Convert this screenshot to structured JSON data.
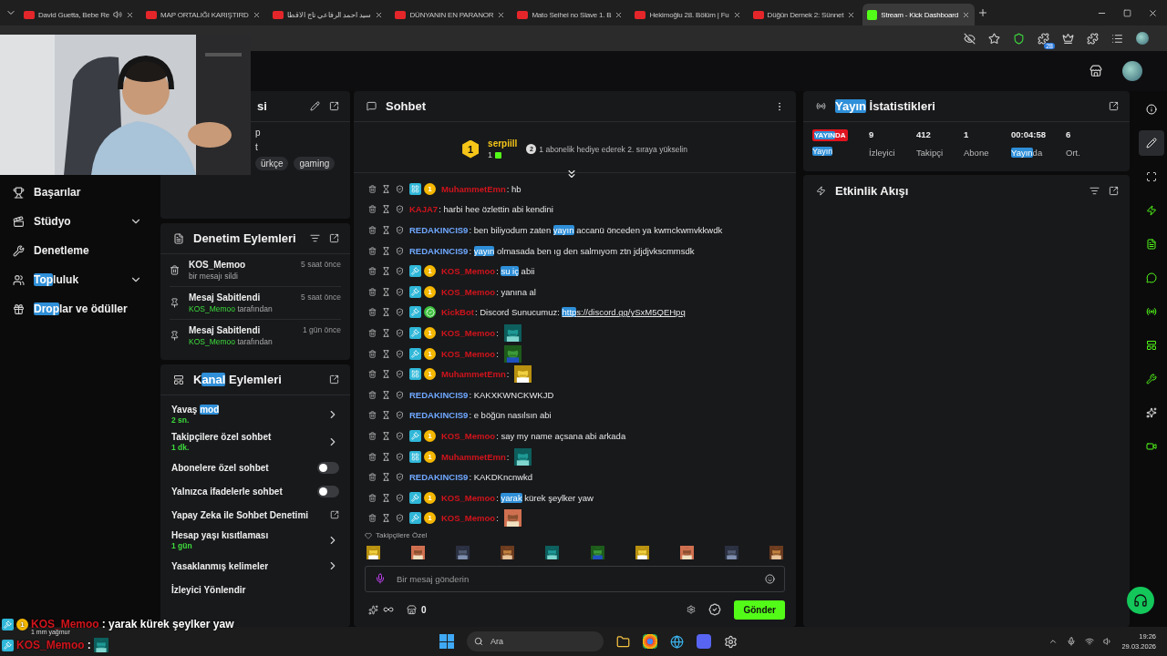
{
  "browser": {
    "tabs": [
      {
        "title": "David Guetta, Bebe Re",
        "selected": false,
        "audio": true
      },
      {
        "title": "MAP ORTALIĞI KARIŞTIRD",
        "selected": false,
        "audio": false
      },
      {
        "title": "سيد احمد الرفاعي تاج الاقطا",
        "selected": false,
        "audio": false
      },
      {
        "title": "DÜNYANIN EN PARANOR",
        "selected": false,
        "audio": false
      },
      {
        "title": "Mato Seihei no Slave 1. B",
        "selected": false,
        "audio": false
      },
      {
        "title": "Hekimoğlu 28. Bölüm | Fu",
        "selected": false,
        "audio": false
      },
      {
        "title": "Düğün Dernek 2: Sünnet",
        "selected": false,
        "audio": false
      },
      {
        "title": "Stream - Kick Dashboard",
        "selected": true,
        "audio": false
      }
    ],
    "extension_badge": "28"
  },
  "sidebar": {
    "items": [
      {
        "parts": [
          {
            "text": "Başarılar"
          }
        ],
        "expandable": false
      },
      {
        "parts": [
          {
            "text": "Stüdyo"
          }
        ],
        "expandable": true
      },
      {
        "parts": [
          {
            "text": "Denetleme"
          }
        ],
        "expandable": false
      },
      {
        "parts": [
          {
            "text": "Top",
            "highlighted": true
          },
          {
            "text": "luluk"
          }
        ],
        "expandable": true
      },
      {
        "parts": [
          {
            "text": "Drop",
            "highlighted": true
          },
          {
            "text": "lar ve ödüller"
          }
        ],
        "expandable": false
      }
    ]
  },
  "info_panel": {
    "title": "si",
    "lines": [
      "p",
      "t"
    ],
    "tags": [
      "ürkçe",
      "gaming"
    ]
  },
  "moderation": {
    "title": [
      {
        "text": "Denetim Eylemleri"
      }
    ],
    "entries": [
      {
        "kind": "delete",
        "title": "KOS_Memoo",
        "time": "5 saat önce",
        "detail": "bir mesajı sildi"
      },
      {
        "kind": "pin",
        "title": "Mesaj Sabitlendi",
        "time": "5 saat önce",
        "user": "KOS_Memoo",
        "detail": "tarafından"
      },
      {
        "kind": "pin",
        "title": "Mesaj Sabitlendi",
        "time": "1 gün önce",
        "user": "KOS_Memoo",
        "detail": "tarafından"
      }
    ]
  },
  "channel_actions": {
    "title": [
      {
        "text": "K"
      },
      {
        "text": "anal",
        "highlighted": true
      },
      {
        "text": " Eylemleri"
      }
    ],
    "items": [
      {
        "kind": "link",
        "label": [
          {
            "text": "Yavaş "
          },
          {
            "text": "mod",
            "highlighted": true
          }
        ],
        "value": "2 sn."
      },
      {
        "kind": "link",
        "label": [
          {
            "text": "Takipçilere özel sohbet"
          }
        ],
        "value": "1 dk."
      },
      {
        "kind": "toggle",
        "label": [
          {
            "text": "Abonelere özel sohbet"
          }
        ],
        "on": false
      },
      {
        "kind": "toggle",
        "label": [
          {
            "text": "Yalnızca ifadelerle sohbet"
          }
        ],
        "on": false
      },
      {
        "kind": "external",
        "label": [
          {
            "text": "Yapay Zeka ile Sohbet Denetimi"
          }
        ]
      },
      {
        "kind": "link",
        "label": [
          {
            "text": "Hesap yaşı kısıtlaması"
          }
        ],
        "value": "1 gün"
      },
      {
        "kind": "link",
        "label": [
          {
            "text": "Yasaklanmış kelimeler"
          }
        ]
      },
      {
        "kind": "plain",
        "label": [
          {
            "text": "İzleyici Yönlendir"
          }
        ]
      }
    ]
  },
  "chat": {
    "title": "Sohbet",
    "leader": {
      "rank": "1",
      "name": "serpiill",
      "count": "1",
      "hint_rank": "2",
      "hint": "1 abonelik hediye ederek 2. sıraya yükselin"
    },
    "messages": [
      {
        "user": "MuhammetEmn",
        "color": "#d0141c",
        "badges": [
          {
            "kind": "og"
          },
          {
            "kind": "sub",
            "label": "1"
          }
        ],
        "parts": [
          {
            "text": ": hb"
          }
        ]
      },
      {
        "user": "KAJA7",
        "color": "#d0141c",
        "parts": [
          {
            "text": ": harbi hee özlettin abi kendini"
          }
        ]
      },
      {
        "user": "REDAKINCIS9",
        "color": "#6fa8ff",
        "parts": [
          {
            "text": ": ben biliyodum zaten "
          },
          {
            "text": "yayın",
            "highlighted": true
          },
          {
            "text": " accanü önceden ya kwmckwmvkkwdk"
          }
        ]
      },
      {
        "user": "REDAKINCIS9",
        "color": "#6fa8ff",
        "parts": [
          {
            "text": ": "
          },
          {
            "text": "yayın",
            "highlighted": true
          },
          {
            "text": " olmasada ben ıg den salmıyom ztn jdjdjvkscmmsdk"
          }
        ]
      },
      {
        "user": "KOS_Memoo",
        "color": "#d0141c",
        "badges": [
          {
            "kind": "mod"
          },
          {
            "kind": "sub",
            "label": "1"
          }
        ],
        "parts": [
          {
            "text": ": "
          },
          {
            "text": "su iç",
            "highlighted": true
          },
          {
            "text": " abii"
          }
        ]
      },
      {
        "user": "KOS_Memoo",
        "color": "#d0141c",
        "badges": [
          {
            "kind": "mod"
          },
          {
            "kind": "sub",
            "label": "1"
          }
        ],
        "parts": [
          {
            "text": ": yanına al"
          }
        ]
      },
      {
        "user": "KickBot",
        "color": "#d0141c",
        "badges": [
          {
            "kind": "mod"
          },
          {
            "kind": "verified"
          }
        ],
        "parts": [
          {
            "text": ": Discord Sunucumuz: "
          },
          {
            "link": [
              {
                "text": "http",
                "highlighted": true
              },
              {
                "text": "s://discord.gg/ySxM5QEHpq"
              }
            ]
          }
        ]
      },
      {
        "user": "KOS_Memoo",
        "color": "#d0141c",
        "badges": [
          {
            "kind": "mod"
          },
          {
            "kind": "sub",
            "label": "1"
          }
        ],
        "parts": [
          {
            "text": ":"
          }
        ],
        "emote": true
      },
      {
        "user": "KOS_Memoo",
        "color": "#d0141c",
        "badges": [
          {
            "kind": "mod"
          },
          {
            "kind": "sub",
            "label": "1"
          }
        ],
        "parts": [
          {
            "text": ":"
          }
        ],
        "emote": true
      },
      {
        "user": "MuhammetEmn",
        "color": "#d0141c",
        "badges": [
          {
            "kind": "og"
          },
          {
            "kind": "sub",
            "label": "1"
          }
        ],
        "parts": [
          {
            "text": ":"
          }
        ],
        "emote": true
      },
      {
        "user": "REDAKINCIS9",
        "color": "#6fa8ff",
        "parts": [
          {
            "text": ": KAKXKWNCKWKJD"
          }
        ]
      },
      {
        "user": "REDAKINCIS9",
        "color": "#6fa8ff",
        "parts": [
          {
            "text": ": e böğün nasılsın abi"
          }
        ]
      },
      {
        "user": "KOS_Memoo",
        "color": "#d0141c",
        "badges": [
          {
            "kind": "mod"
          },
          {
            "kind": "sub",
            "label": "1"
          }
        ],
        "parts": [
          {
            "text": ": say my name açsana abi arkada"
          }
        ]
      },
      {
        "user": "MuhammetEmn",
        "color": "#d0141c",
        "badges": [
          {
            "kind": "og"
          },
          {
            "kind": "sub",
            "label": "1"
          }
        ],
        "parts": [
          {
            "text": ":"
          }
        ],
        "emote": true
      },
      {
        "user": "REDAKINCIS9",
        "color": "#6fa8ff",
        "parts": [
          {
            "text": ": KAKDKncnwkd"
          }
        ]
      },
      {
        "user": "KOS_Memoo",
        "color": "#d0141c",
        "badges": [
          {
            "kind": "mod"
          },
          {
            "kind": "sub",
            "label": "1"
          }
        ],
        "parts": [
          {
            "text": ": "
          },
          {
            "text": "yarak",
            "highlighted": true
          },
          {
            "text": " kürek şeylker yaw"
          }
        ]
      },
      {
        "user": "KOS_Memoo",
        "color": "#d0141c",
        "badges": [
          {
            "kind": "mod"
          },
          {
            "kind": "sub",
            "label": "1"
          }
        ],
        "parts": [
          {
            "text": ":"
          }
        ],
        "emote": true
      }
    ],
    "emote_group": "Takipçilere Özel",
    "placeholder": "Bir mesaj gönderin",
    "points": "0",
    "send": "Gönder"
  },
  "stats": {
    "title": [
      {
        "text": "Yayın",
        "highlighted": true
      },
      {
        "text": " İstatistikleri"
      }
    ],
    "live": [
      {
        "text": "YAYIN",
        "highlighted": true
      },
      {
        "text": "DA"
      }
    ],
    "status": [
      {
        "text": "Yayın",
        "highlighted": true
      }
    ],
    "items": [
      {
        "value": "9",
        "label": [
          {
            "text": "İzleyici"
          }
        ]
      },
      {
        "value": "412",
        "label": [
          {
            "text": "Takipçi"
          }
        ]
      },
      {
        "value": "1",
        "label": [
          {
            "text": "Abone"
          }
        ]
      },
      {
        "value": "00:04:58",
        "label": [
          {
            "text": "Yayın",
            "highlighted": true
          },
          {
            "text": "da"
          }
        ]
      },
      {
        "value": "6",
        "label": [
          {
            "text": "Ort."
          }
        ]
      }
    ]
  },
  "activity": {
    "title": "Etkinlik Akışı"
  },
  "right_rail": [
    {
      "selected": false
    },
    {
      "selected": true
    },
    {
      "selected": false
    },
    {
      "selected": false
    },
    {
      "selected": false
    },
    {
      "selected": false
    },
    {
      "selected": false
    },
    {
      "selected": false
    },
    {
      "selected": false
    },
    {
      "selected": false
    },
    {
      "selected": false
    }
  ],
  "overlay_chat": [
    {
      "user": "KOS_Memoo",
      "badges": [
        {
          "kind": "mod"
        },
        {
          "kind": "sub",
          "label": "1"
        }
      ],
      "parts": [
        {
          "text": " : yarak kürek şeylker yaw"
        }
      ]
    },
    {
      "user": "KOS_Memoo",
      "badges": [
        {
          "kind": "mod"
        }
      ],
      "parts": [
        {
          "text": " :"
        }
      ],
      "emote": true
    }
  ],
  "taskbar": {
    "weather": "1 mm yağmur",
    "placeholder": "Ara",
    "time": "19:26",
    "date": "29.03.2026"
  }
}
